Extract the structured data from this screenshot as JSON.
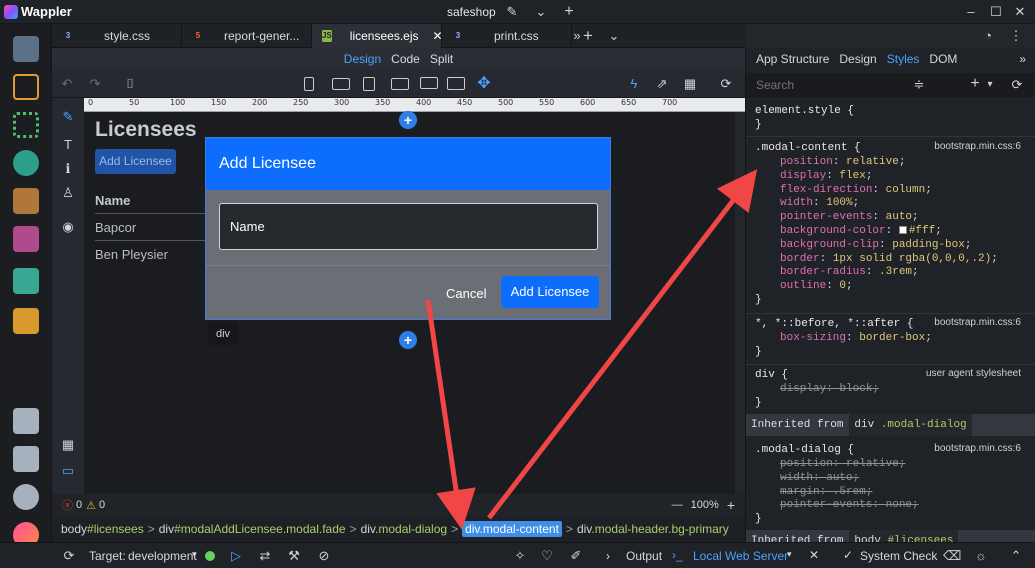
{
  "app": {
    "name": "Wappler",
    "project": "safeshop"
  },
  "tabs": [
    {
      "label": "style.css",
      "type": "css"
    },
    {
      "label": "report-gener...",
      "type": "html"
    },
    {
      "label": "licensees.ejs",
      "type": "js",
      "active": true
    },
    {
      "label": "print.css",
      "type": "css"
    }
  ],
  "view_tabs": {
    "design": "Design",
    "code": "Code",
    "split": "Split",
    "active": "Design"
  },
  "ruler": {
    "ticks": [
      "0",
      "50",
      "100",
      "150",
      "200",
      "250",
      "300",
      "350",
      "400",
      "450",
      "500",
      "550",
      "600",
      "650",
      "700"
    ]
  },
  "page": {
    "heading": "Licensees",
    "add_button": "Add Licensee",
    "table_header": "Name",
    "rows": [
      "Bapcor",
      "Ben Pleysier"
    ]
  },
  "modal": {
    "title": "Add Licensee",
    "field_label": "Name",
    "cancel": "Cancel",
    "submit": "Add Licensee",
    "element_tag": "div"
  },
  "canvas_status": {
    "errors": "0",
    "warnings": "0",
    "zoom": "100%"
  },
  "breadcrumbs": [
    {
      "tag": "body",
      "cls": "#licensees"
    },
    {
      "tag": "div",
      "cls": "#modalAddLicensee.modal.fade"
    },
    {
      "tag": "div",
      "cls": ".modal-dialog"
    },
    {
      "tag": "div",
      "cls": ".modal-content",
      "highlighted": true
    },
    {
      "tag": "div",
      "cls": ".modal-header.bg-primary"
    }
  ],
  "bottom": {
    "target_label": "Target:",
    "target_value": "development",
    "output": "Output",
    "server": "Local Web Server",
    "system_check": "System Check"
  },
  "right_panel": {
    "tabs": [
      "App Structure",
      "Design",
      "Styles",
      "DOM"
    ],
    "active_tab": "Styles",
    "search_placeholder": "Search",
    "element_style": {
      "selector": "element.style {",
      "close": "}"
    },
    "modal_content": {
      "selector": ".modal-content {",
      "source": "bootstrap.min.css:6",
      "props": [
        {
          "name": "position",
          "value": "relative"
        },
        {
          "name": "display",
          "value": "flex"
        },
        {
          "name": "flex-direction",
          "value": "column"
        },
        {
          "name": "width",
          "value": "100%"
        },
        {
          "name": "pointer-events",
          "value": "auto"
        },
        {
          "name": "background-color",
          "value": "#fff"
        },
        {
          "name": "background-clip",
          "value": "padding-box"
        },
        {
          "name": "border",
          "value": "1px solid rgba(0,0,0,.2)"
        },
        {
          "name": "border-radius",
          "value": ".3rem"
        },
        {
          "name": "outline",
          "value": "0"
        }
      ],
      "close": "}"
    },
    "universal": {
      "selector": "*, *::before, *::after {",
      "source": "bootstrap.min.css:6",
      "props": [
        {
          "name": "box-sizing",
          "value": "border-box"
        }
      ],
      "close": "}"
    },
    "div_rule": {
      "selector": "div {",
      "source": "user agent stylesheet",
      "props": [
        {
          "name": "display",
          "value": "block"
        }
      ],
      "close": "}"
    },
    "inherited_1": {
      "label": "Inherited from",
      "tag": "div",
      "cls": ".modal-dialog"
    },
    "modal_dialog": {
      "selector": ".modal-dialog {",
      "source": "bootstrap.min.css:6",
      "props": [
        {
          "name": "position",
          "value": "relative"
        },
        {
          "name": "width",
          "value": "auto"
        },
        {
          "name": "margin",
          "value": ".5rem"
        },
        {
          "name": "pointer-events",
          "value": "none"
        }
      ],
      "close": "}"
    },
    "inherited_2": {
      "label": "Inherited from",
      "tag": "body",
      "cls": "#licensees"
    }
  },
  "colors": {
    "primary": "#0d6efd",
    "accent": "#4aa3ff",
    "highlight": "#3f8fe8",
    "arrow": "#f04646"
  }
}
